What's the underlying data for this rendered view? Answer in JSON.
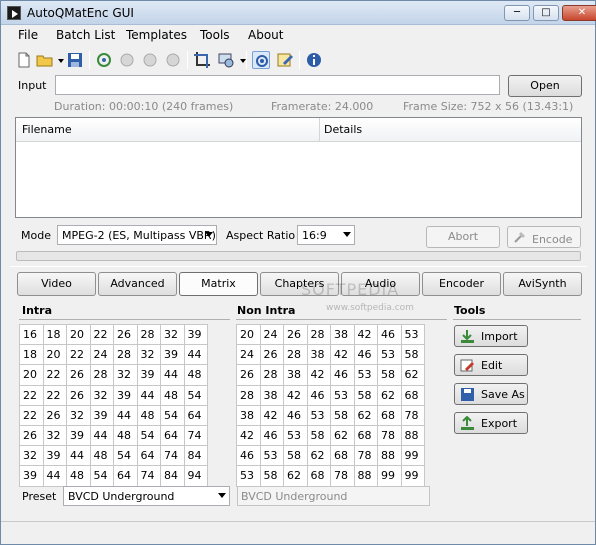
{
  "window": {
    "title": "AutoQMatEnc GUI",
    "minimize": "─",
    "maximize": "□",
    "close": "✕"
  },
  "menu": [
    "File",
    "Batch List",
    "Templates",
    "Tools",
    "About"
  ],
  "toolbar": {
    "icons": [
      "new-file-icon",
      "open-folder-icon",
      "save-icon",
      "refresh-icon",
      "disabled-icon-1",
      "disabled-icon-2",
      "disabled-icon-3",
      "crop-icon",
      "preview-icon",
      "settings-icon",
      "edit-icon",
      "info-icon"
    ]
  },
  "input": {
    "label": "Input",
    "value": "",
    "open_label": "Open"
  },
  "info": {
    "duration": "Duration: 00:00:10 (240 frames)",
    "framerate": "Framerate: 24.000",
    "framesize": "Frame Size: 752 x 56 (13.43:1)"
  },
  "list": {
    "columns": [
      "Filename",
      "Details"
    ]
  },
  "mode": {
    "label": "Mode",
    "value": "MPEG-2 (ES, Multipass VBR)"
  },
  "aspect": {
    "label": "Aspect Ratio",
    "value": "16:9"
  },
  "actions": {
    "abort": "Abort",
    "encode": "Encode"
  },
  "tabs": [
    "Video",
    "Advanced",
    "Matrix",
    "Chapters",
    "Audio",
    "Encoder",
    "AviSynth"
  ],
  "intra": {
    "title": "Intra",
    "rows": [
      [
        "16",
        "18",
        "20",
        "22",
        "26",
        "28",
        "32",
        "39"
      ],
      [
        "18",
        "20",
        "22",
        "24",
        "28",
        "32",
        "39",
        "44"
      ],
      [
        "20",
        "22",
        "26",
        "28",
        "32",
        "39",
        "44",
        "48"
      ],
      [
        "22",
        "22",
        "26",
        "32",
        "39",
        "44",
        "48",
        "54"
      ],
      [
        "22",
        "26",
        "32",
        "39",
        "44",
        "48",
        "54",
        "64"
      ],
      [
        "26",
        "32",
        "39",
        "44",
        "48",
        "54",
        "64",
        "74"
      ],
      [
        "32",
        "39",
        "44",
        "48",
        "54",
        "64",
        "74",
        "84"
      ],
      [
        "39",
        "44",
        "48",
        "54",
        "64",
        "74",
        "84",
        "94"
      ]
    ]
  },
  "nonintra": {
    "title": "Non Intra",
    "rows": [
      [
        "20",
        "24",
        "26",
        "28",
        "38",
        "42",
        "46",
        "53"
      ],
      [
        "24",
        "26",
        "28",
        "38",
        "42",
        "46",
        "53",
        "58"
      ],
      [
        "26",
        "28",
        "38",
        "42",
        "46",
        "53",
        "58",
        "62"
      ],
      [
        "28",
        "38",
        "42",
        "46",
        "53",
        "58",
        "62",
        "68"
      ],
      [
        "38",
        "42",
        "46",
        "53",
        "58",
        "62",
        "68",
        "78"
      ],
      [
        "42",
        "46",
        "53",
        "58",
        "62",
        "68",
        "78",
        "88"
      ],
      [
        "46",
        "53",
        "58",
        "62",
        "68",
        "78",
        "88",
        "99"
      ],
      [
        "53",
        "58",
        "62",
        "68",
        "78",
        "88",
        "99",
        "99"
      ]
    ]
  },
  "tools": {
    "title": "Tools",
    "import": "Import",
    "edit": "Edit",
    "save_as": "Save As",
    "export": "Export"
  },
  "preset": {
    "label": "Preset",
    "value": "BVCD Underground",
    "name_field": "BVCD Underground"
  },
  "watermark": {
    "text": "SOFTPEDIA",
    "url": "www.softpedia.com"
  }
}
